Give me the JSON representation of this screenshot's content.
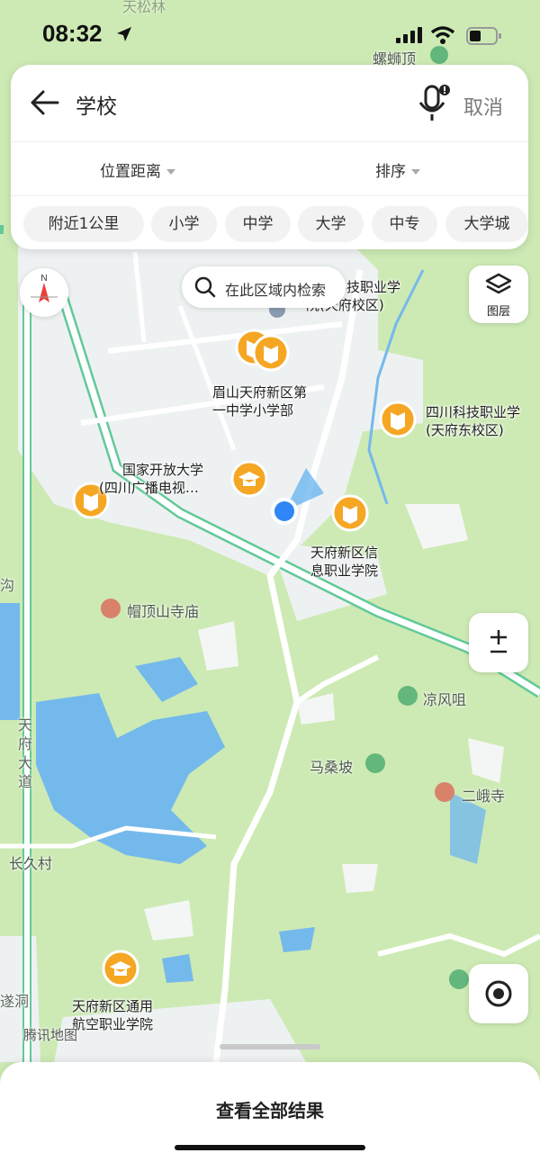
{
  "status_bar": {
    "time": "08:32"
  },
  "search": {
    "query": "学校",
    "cancel_label": "取消",
    "filters": [
      "位置距离",
      "排序"
    ],
    "chips": [
      "附近1公里",
      "小学",
      "中学",
      "大学",
      "中专",
      "大学城"
    ]
  },
  "map": {
    "region_search_label": "在此区域内检索",
    "layers_label": "图层",
    "compass_label": "N",
    "watermark": "腾讯地图",
    "pois": [
      {
        "name": "四川科技职业学院(天府校区)",
        "lines": [
          "四川科技职业学",
          "院(天府校区)"
        ],
        "category": "school"
      },
      {
        "name": "眉山天府新区第一中学小学部",
        "lines": [
          "眉山天府新区第",
          "一中学小学部"
        ],
        "category": "school"
      },
      {
        "name": "四川科技职业学院(天府东校区)",
        "lines": [
          "四川科技职业学",
          "(天府东校区)"
        ],
        "category": "school"
      },
      {
        "name": "国家开放大学(四川广播电视...",
        "lines": [
          "国家开放大学",
          "(四川广播电视…"
        ],
        "category": "university"
      },
      {
        "name": "天府新区信息职业学院",
        "lines": [
          "天府新区信",
          "息职业学院"
        ],
        "category": "school"
      },
      {
        "name": "天府新区通用航空职业学院",
        "lines": [
          "天府新区通用",
          "航空职业学院"
        ],
        "category": "university"
      }
    ],
    "places": [
      "帽顶山寺庙",
      "凉风咀",
      "马桑坡",
      "二峨寺",
      "螺蛳顶",
      "长久村",
      "天松林"
    ],
    "roads": [
      "天府大道",
      "沟",
      "遂洞"
    ],
    "colors": {
      "land": "#cdeab4",
      "urban": "#eef1f2",
      "water": "#74b9ec",
      "road_edge": "#62c999",
      "pin": "#f5a623"
    }
  },
  "bottom_sheet": {
    "view_all_label": "查看全部结果"
  }
}
